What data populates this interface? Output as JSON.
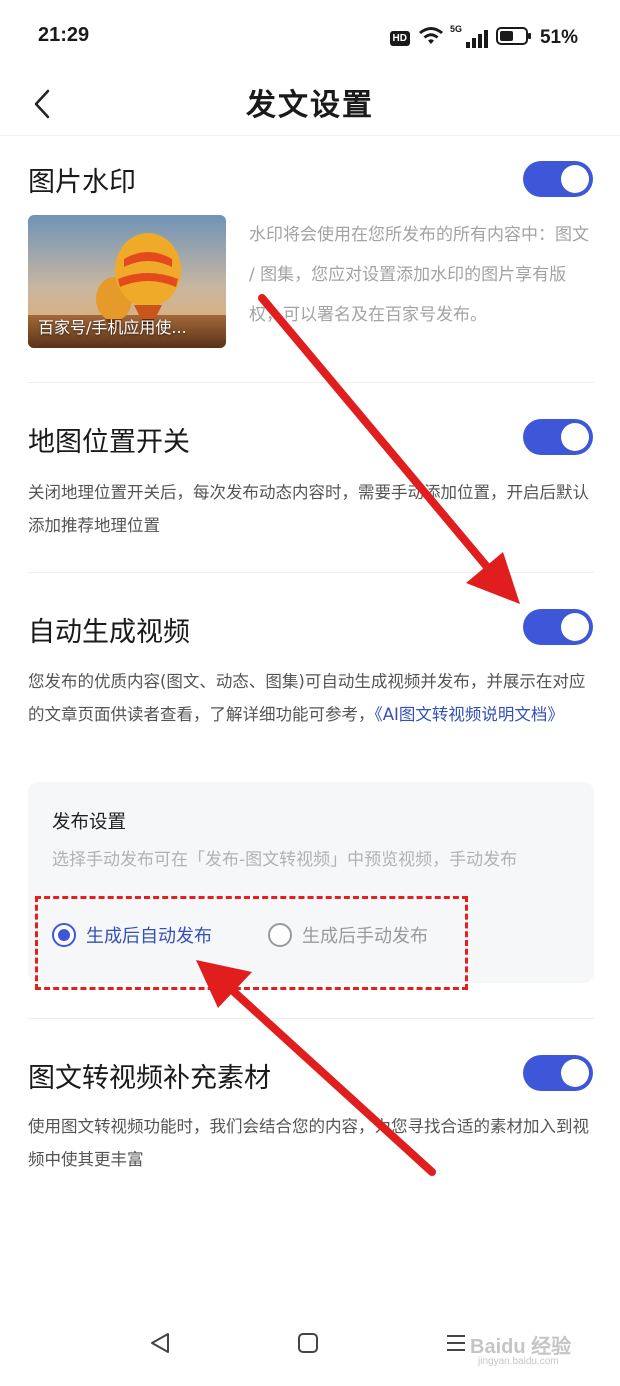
{
  "status_bar": {
    "time": "21:29",
    "hd": "HD",
    "network": "5G",
    "battery": "51%"
  },
  "header": {
    "title": "发文设置"
  },
  "watermark_section": {
    "title": "图片水印",
    "toggle_on": true,
    "image_caption": "百家号/手机应用使...",
    "description": "水印将会使用在您所发布的所有内容中：图文 / 图集，您应对设置添加水印的图片享有版权，可以署名及在百家号发布。"
  },
  "location_section": {
    "title": "地图位置开关",
    "toggle_on": true,
    "description": "关闭地理位置开关后，每次发布动态内容时，需要手动添加位置，开启后默认添加推荐地理位置"
  },
  "video_section": {
    "title": "自动生成视频",
    "toggle_on": true,
    "description": "您发布的优质内容(图文、动态、图集)可自动生成视频并发布，并展示在对应的文章页面供读者查看，了解详细功能可参考，",
    "link_text": "《AI图文转视频说明文档》"
  },
  "publish_card": {
    "title": "发布设置",
    "description": "选择手动发布可在「发布-图文转视频」中预览视频，手动发布",
    "options": [
      {
        "label": "生成后自动发布",
        "checked": true
      },
      {
        "label": "生成后手动发布",
        "checked": false
      }
    ]
  },
  "material_section": {
    "title": "图文转视频补充素材",
    "toggle_on": true,
    "description": "使用图文转视频功能时，我们会结合您的内容，为您寻找合适的素材加入到视频中使其更丰富"
  },
  "watermark_overlay": {
    "brand": "Baidu 经验",
    "url": "jingyan.baidu.com"
  },
  "colors": {
    "accent": "#3e57d8",
    "annotation": "#e32020",
    "link": "#3550b8"
  }
}
